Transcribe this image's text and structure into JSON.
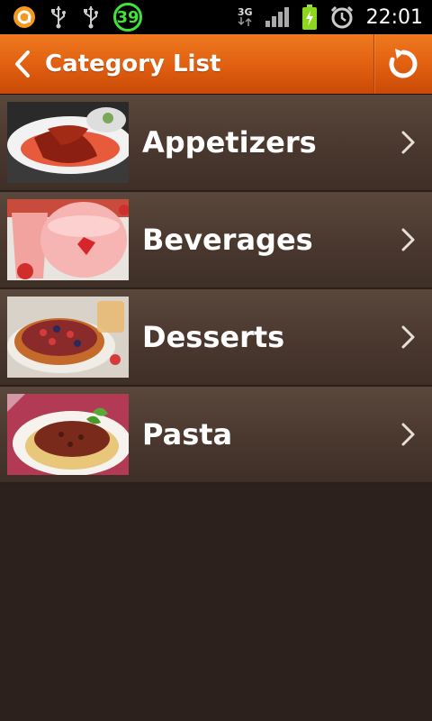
{
  "status_bar": {
    "notification_badge": "39",
    "network_type": "3G",
    "time": "22:01",
    "icons": [
      "app-notification-icon",
      "usb-icon",
      "usb-icon",
      "signal-icon",
      "battery-charging-icon",
      "alarm-icon"
    ]
  },
  "header": {
    "title": "Category List",
    "back_icon": "chevron-left-icon",
    "refresh_icon": "refresh-icon"
  },
  "categories": [
    {
      "label": "Appetizers",
      "image": "appetizers-photo"
    },
    {
      "label": "Beverages",
      "image": "beverages-photo"
    },
    {
      "label": "Desserts",
      "image": "desserts-photo"
    },
    {
      "label": "Pasta",
      "image": "pasta-photo"
    }
  ],
  "colors": {
    "header_orange": "#e36110",
    "list_brown": "#4a382f",
    "background": "#2d211d",
    "badge_green": "#3fe33a"
  }
}
